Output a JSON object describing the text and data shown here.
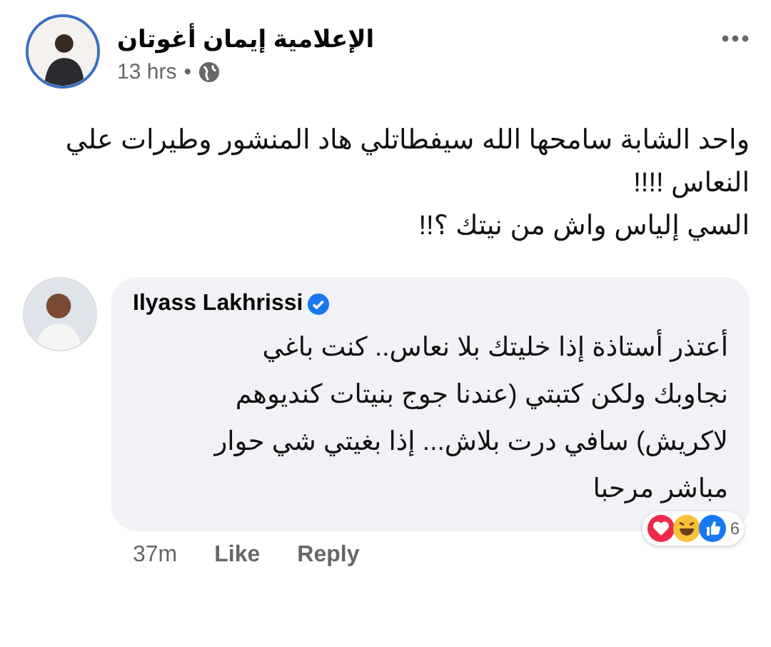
{
  "post": {
    "author": "الإعلامية إيمان أغوتان",
    "time": "13 hrs",
    "separator": "•",
    "lines": [
      "واحد الشابة سامحها الله سيفطاتلي هاد المنشور وطيرات علي",
      "النعاس !!!!",
      "السي إلياس واش من نيتك ؟!!"
    ]
  },
  "comment": {
    "author": "Ilyass Lakhrissi",
    "verified": true,
    "lines": [
      "أعتذر أستاذة إذا خليتك بلا نعاس.. كنت باغي",
      "نجاوبك ولكن كتبتي (عندنا جوج بنيتات كنديوهم",
      "لاكريش) سافي درت بلاش... إذا بغيتي شي حوار",
      "مباشر مرحبا"
    ],
    "time": "37m",
    "like_action": "Like",
    "reply_action": "Reply",
    "reactions": [
      {
        "kind": "love"
      },
      {
        "kind": "haha"
      },
      {
        "kind": "like"
      }
    ],
    "reaction_count": "6"
  }
}
